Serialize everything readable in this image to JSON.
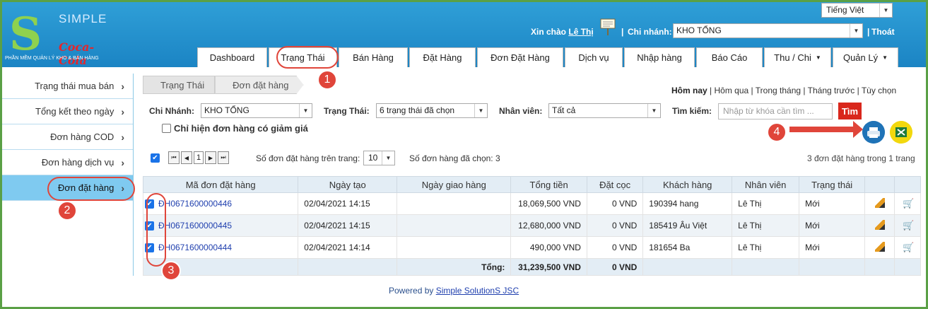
{
  "header": {
    "logo_text": "SIMPLE",
    "logo_brand": "Coca-Cola",
    "logo_tagline": "PHẦN MỀM QUẢN LÝ KHO & BÁN HÀNG",
    "language": "Tiếng Việt",
    "greeting": "Xin chào",
    "user": "Lê Thị",
    "branch_label": "Chi nhánh:",
    "branch_value": "KHO TỔNG",
    "logout": "Thoát",
    "separator": "|"
  },
  "nav": [
    {
      "label": "Dashboard"
    },
    {
      "label": "Trạng Thái"
    },
    {
      "label": "Bán Hàng"
    },
    {
      "label": "Đặt Hàng"
    },
    {
      "label": "Đơn Đặt Hàng"
    },
    {
      "label": "Dịch vụ"
    },
    {
      "label": "Nhập hàng"
    },
    {
      "label": "Báo Cáo"
    },
    {
      "label": "Thu / Chi"
    },
    {
      "label": "Quản Lý"
    }
  ],
  "sidebar": {
    "items": [
      {
        "label": "Trạng thái mua bán"
      },
      {
        "label": "Tổng kết theo ngày"
      },
      {
        "label": "Đơn hàng COD"
      },
      {
        "label": "Đơn hàng dịch vụ"
      },
      {
        "label": "Đơn đặt hàng"
      }
    ]
  },
  "breadcrumb": [
    "Trạng Thái",
    "Đơn đặt hàng"
  ],
  "date_range": {
    "today": "Hôm nay",
    "yesterday": "Hôm qua",
    "this_month": "Trong tháng",
    "last_month": "Tháng trước",
    "custom": "Tùy chọn",
    "sep": "|"
  },
  "filters": {
    "branch_label": "Chi Nhánh:",
    "branch_value": "KHO TỔNG",
    "status_label": "Trạng Thái:",
    "status_value": "6 trạng thái đã chọn",
    "staff_label": "Nhân viên:",
    "staff_value": "Tất cả",
    "search_label": "Tìm kiếm:",
    "search_placeholder": "Nhập từ khóa cần tìm ...",
    "search_button": "Tìm",
    "discount_only": "Chỉ hiện đơn hàng có giảm giá"
  },
  "pager": {
    "page": "1",
    "per_page_label": "Số đơn đặt hàng trên trang:",
    "per_page": "10",
    "selected_label": "Số đơn hàng đã chọn: 3",
    "summary": "3 đơn đặt hàng trong 1 trang"
  },
  "table": {
    "headers": [
      "Mã đơn đặt hàng",
      "Ngày tạo",
      "Ngày giao hàng",
      "Tổng tiền",
      "Đặt cọc",
      "Khách hàng",
      "Nhân viên",
      "Trạng thái"
    ],
    "rows": [
      {
        "code": "ĐH0671600000446",
        "created": "02/04/2021 14:15",
        "delivery": "",
        "total": "18,069,500 VND",
        "deposit": "0 VND",
        "customer": "190394 hang",
        "staff": "Lê Thị",
        "status": "Mới"
      },
      {
        "code": "ĐH0671600000445",
        "created": "02/04/2021 14:15",
        "delivery": "",
        "total": "12,680,000 VND",
        "deposit": "0 VND",
        "customer": "185419 Âu Việt",
        "staff": "Lê Thị",
        "status": "Mới"
      },
      {
        "code": "ĐH0671600000444",
        "created": "02/04/2021 14:14",
        "delivery": "",
        "total": "490,000 VND",
        "deposit": "0 VND",
        "customer": "181654 Ba",
        "staff": "Lê Thị",
        "status": "Mới"
      }
    ],
    "total_label": "Tổng:",
    "total_amount": "31,239,500 VND",
    "total_deposit": "0 VND"
  },
  "footer": {
    "powered": "Powered by",
    "company": "Simple SolutionS JSC"
  },
  "annotations": {
    "b1": "1",
    "b2": "2",
    "b3": "3",
    "b4": "4",
    "color": "#e0453a"
  }
}
